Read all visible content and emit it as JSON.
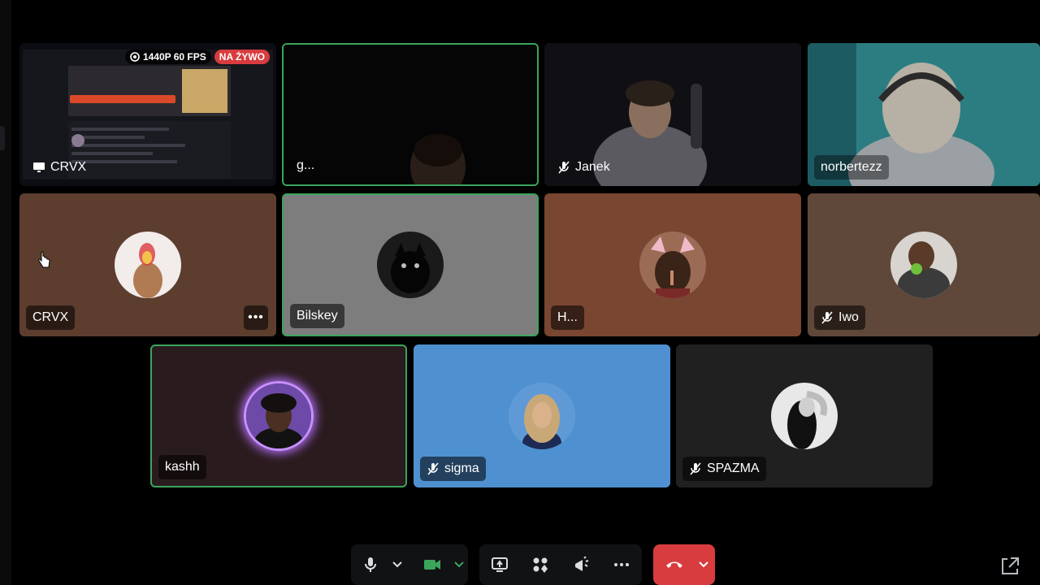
{
  "participants": [
    {
      "id": "crvx-stream",
      "name": "CRVX",
      "type": "screen-share",
      "badges": {
        "quality": "1440P 60 FPS",
        "live": "NA ŻYWO"
      }
    },
    {
      "id": "g",
      "name": "g...",
      "type": "camera",
      "speaking": true
    },
    {
      "id": "janek",
      "name": "Janek",
      "type": "camera",
      "muted": true
    },
    {
      "id": "norbertezz",
      "name": "norbertezz",
      "type": "camera"
    },
    {
      "id": "crvx",
      "name": "CRVX",
      "type": "avatar",
      "bg": "#5c3d2e"
    },
    {
      "id": "bilskey",
      "name": "Bilskey",
      "type": "avatar",
      "speaking": true,
      "bg": "#7d7d7d"
    },
    {
      "id": "h",
      "name": "H...",
      "type": "avatar",
      "bg": "#794632"
    },
    {
      "id": "iwo",
      "name": "Iwo",
      "type": "avatar",
      "muted": true,
      "bg": "#5f4839"
    },
    {
      "id": "kashh",
      "name": "kashh",
      "type": "avatar",
      "speaking": true,
      "bg": "#2a1b1e"
    },
    {
      "id": "sigma",
      "name": "sigma",
      "type": "avatar",
      "muted": true,
      "bg": "#4f91d0"
    },
    {
      "id": "spazma",
      "name": "SPAZMA",
      "type": "avatar",
      "muted": true,
      "bg": "#202021"
    }
  ],
  "more_options_label": "•••",
  "controls": {
    "icons": [
      "microphone-icon",
      "chevron-down-icon",
      "camera-icon",
      "chevron-down-icon",
      "screen-share-icon",
      "activities-icon",
      "soundboard-icon",
      "more-icon",
      "hang-up-icon",
      "chevron-down-icon",
      "popout-icon"
    ]
  },
  "colors": {
    "speaking": "#3ba55c",
    "live": "#d83c3e",
    "camera_active": "#3ba55c"
  }
}
